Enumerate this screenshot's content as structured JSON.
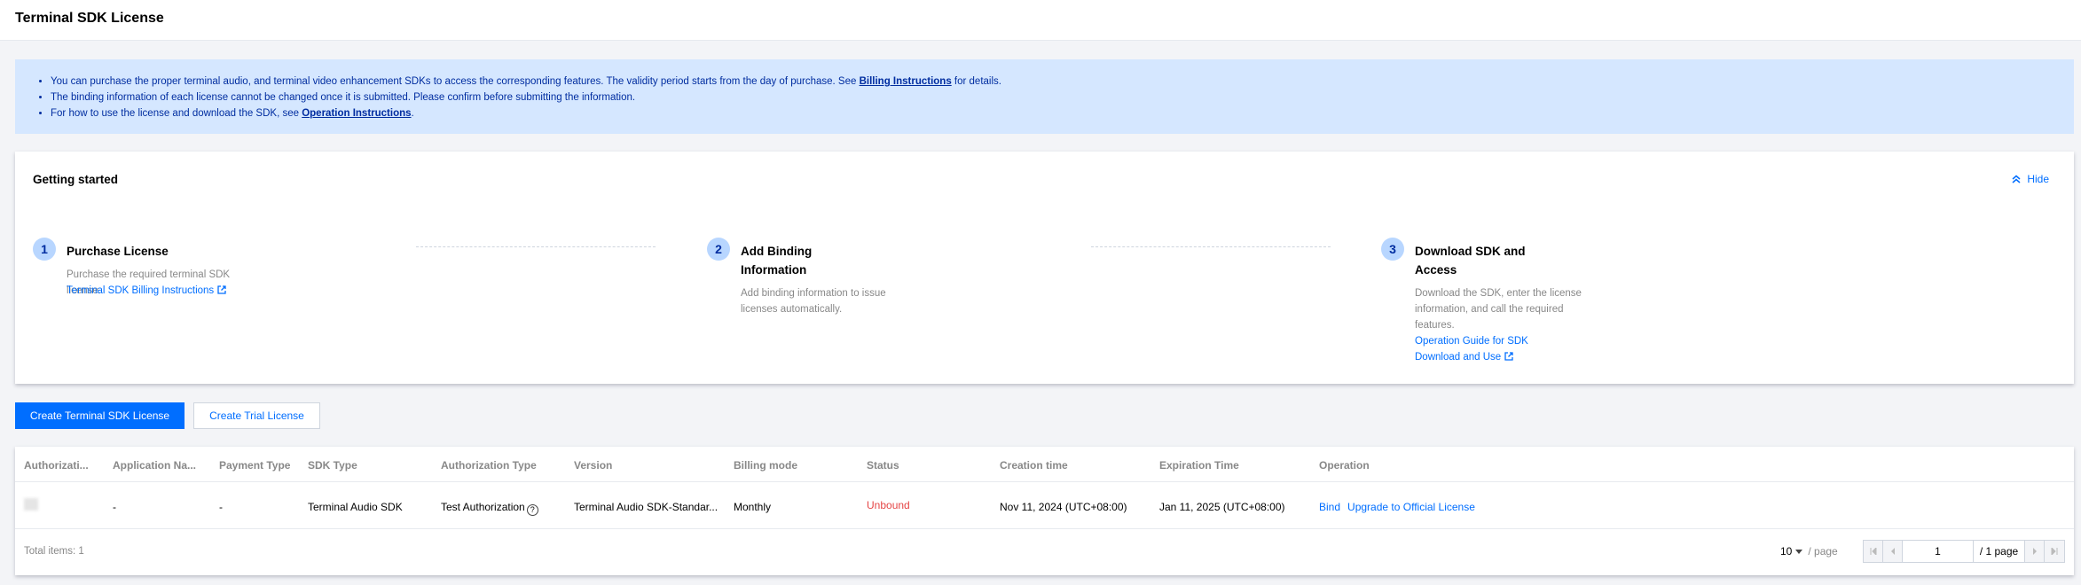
{
  "header": {
    "title": "Terminal SDK License"
  },
  "notice": {
    "line1_prefix": "You can purchase the proper terminal audio, and terminal video enhancement SDKs to access the corresponding features. The validity period starts from the day of purchase. See ",
    "line1_link": "Billing Instructions",
    "line1_suffix": " for details.",
    "line2": "The binding information of each license cannot be changed once it is submitted. Please confirm before submitting the information.",
    "line3_prefix": "For how to use the license and download the SDK, see ",
    "line3_link": "Operation Instructions",
    "line3_suffix": "."
  },
  "getting_started": {
    "title": "Getting started",
    "hide_label": "Hide",
    "steps": [
      {
        "num": "1",
        "title": "Purchase License",
        "desc": "Purchase the required terminal SDK license.",
        "link": "Terminal SDK Billing Instructions"
      },
      {
        "num": "2",
        "title": "Add Binding Information",
        "desc": "Add binding information to issue licenses automatically."
      },
      {
        "num": "3",
        "title": "Download SDK and Access",
        "desc": "Download the SDK, enter the license information, and call the required features.",
        "link": "Operation Guide for SDK Download and Use"
      }
    ]
  },
  "actions": {
    "create_label": "Create Terminal SDK License",
    "trial_label": "Create Trial License"
  },
  "table": {
    "columns": [
      "Authorizati...",
      "Application Na...",
      "Payment Type",
      "SDK Type",
      "Authorization Type",
      "Version",
      "Billing mode",
      "Status",
      "Creation time",
      "Expiration Time",
      "Operation"
    ],
    "rows": [
      {
        "application_name": "-",
        "payment_type": "-",
        "sdk_type": "Terminal Audio SDK",
        "auth_type": "Test Authorization",
        "version": "Terminal Audio SDK-Standar...",
        "billing_mode": "Monthly",
        "status": "Unbound",
        "creation_time": "Nov 11, 2024  (UTC+08:00)",
        "expiration_time": "Jan 11, 2025  (UTC+08:00)",
        "op_bind": "Bind",
        "op_upgrade": "Upgrade to Official License"
      }
    ],
    "footer": {
      "total": "Total items:  1",
      "page_size": "10",
      "page_size_suffix": "/ page",
      "current_page": "1",
      "total_pages": "/ 1 page"
    }
  },
  "colors": {
    "primary": "#006eff",
    "notice_bg": "#d5e7ff",
    "status_unbound": "#e54545"
  }
}
